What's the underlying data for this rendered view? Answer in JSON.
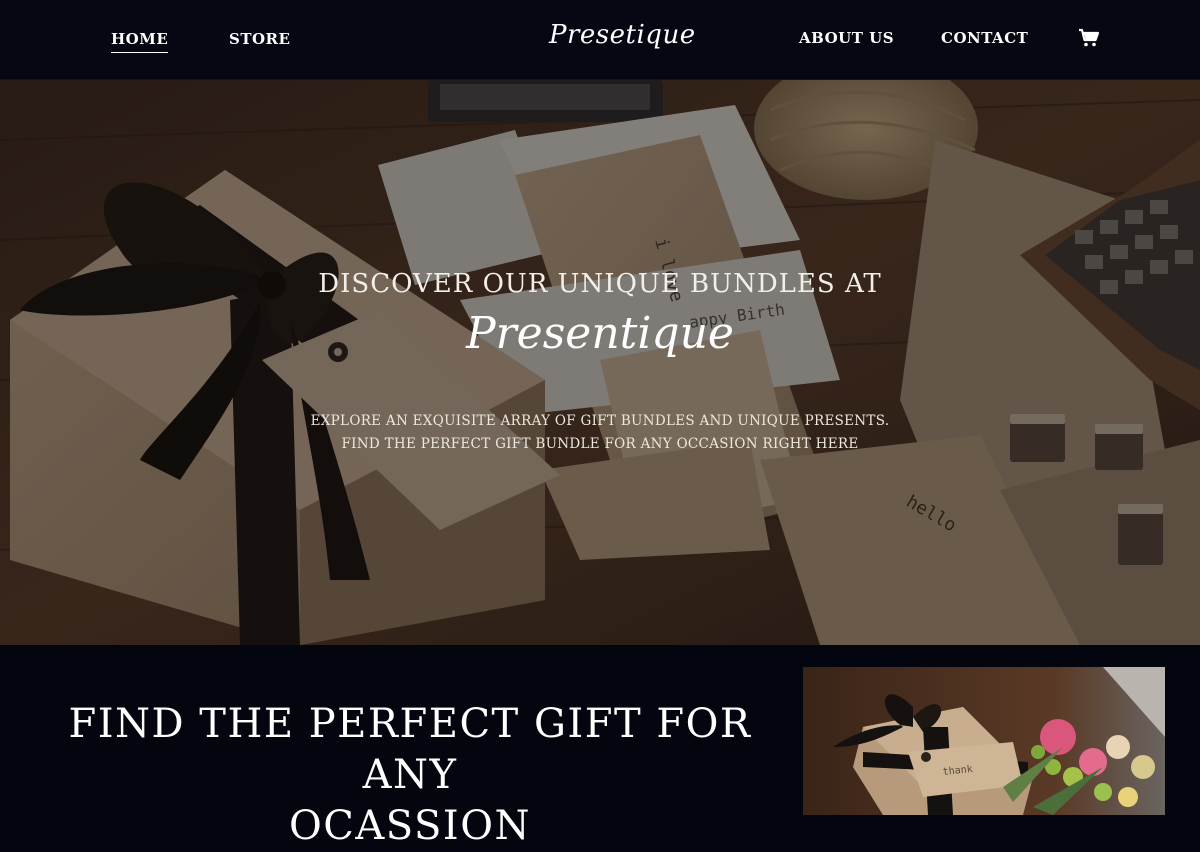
{
  "nav": {
    "home_label": "HOME",
    "store_label": "STORE",
    "logo_text": "Presetique",
    "about_label": "ABOUT US",
    "contact_label": "CONTACT",
    "cart_icon": "shopping-cart-icon"
  },
  "hero": {
    "heading": "DISCOVER OUR UNIQUE BUNDLES AT",
    "brand_script": "Presentique",
    "subtitle_line1": "EXPLORE AN EXQUISITE ARRAY OF GIFT BUNDLES AND UNIQUE PRESENTS.",
    "subtitle_line2": "FIND THE PERFECT GIFT BUNDLE FOR ANY OCCASION RIGHT HERE",
    "photo_tags": [
      "i love",
      "happy birth",
      "hello",
      "thank"
    ]
  },
  "feature": {
    "heading_line1": "FIND THE PERFECT GIFT FOR ANY",
    "heading_line2": "OCASSION",
    "photo_tag": "thank"
  },
  "colors": {
    "nav_bg": "#050713",
    "section_bg": "#04060f",
    "text": "#ffffff",
    "kraft_paper": "#b89e82",
    "ribbon": "#15110f",
    "wood": "#4a3224"
  }
}
